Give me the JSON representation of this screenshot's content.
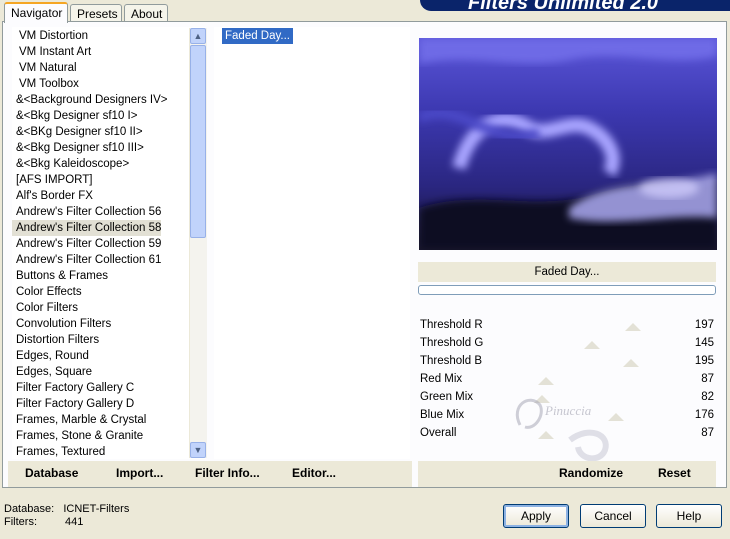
{
  "tabs": [
    "Navigator",
    "Presets",
    "About"
  ],
  "banner_title": "Filters Unlimited 2.0",
  "categories": [
    "VM Distortion",
    "VM Instant Art",
    "VM Natural",
    "VM Toolbox",
    "&<Background Designers IV>",
    "&<Bkg Designer sf10 I>",
    "&<BKg Designer sf10 II>",
    "&<Bkg Designer sf10 III>",
    "&<Bkg Kaleidoscope>",
    "[AFS IMPORT]",
    "Alf's Border FX",
    "Andrew's Filter Collection 56",
    "Andrew's Filter Collection 58",
    "Andrew's Filter Collection 59",
    "Andrew's Filter Collection 61",
    "Buttons & Frames",
    "Color Effects",
    "Color Filters",
    "Convolution Filters",
    "Distortion Filters",
    "Edges, Round",
    "Edges, Square",
    "Filter Factory Gallery C",
    "Filter Factory Gallery D",
    "Frames, Marble & Crystal",
    "Frames, Stone & Granite",
    "Frames, Textured"
  ],
  "selected_category": "Andrew's Filter Collection 58",
  "filters": [
    "Faded Day..."
  ],
  "selected_filter": "Faded Day...",
  "preview_filter_name": "Faded Day...",
  "sliders": [
    {
      "name": "Threshold R",
      "value": 197
    },
    {
      "name": "Threshold G",
      "value": 145
    },
    {
      "name": "Threshold B",
      "value": 195
    },
    {
      "name": "Red Mix",
      "value": 87
    },
    {
      "name": "Green Mix",
      "value": 82
    },
    {
      "name": "Blue Mix",
      "value": 176
    },
    {
      "name": "Overall",
      "value": 87
    }
  ],
  "left_buttons": {
    "database": "Database",
    "import": "Import...",
    "filter_info": "Filter Info...",
    "editor": "Editor..."
  },
  "right_buttons": {
    "randomize": "Randomize",
    "reset": "Reset"
  },
  "status": {
    "database_label": "Database:",
    "database_value": "ICNET-Filters",
    "filters_label": "Filters:",
    "filters_value": "441"
  },
  "dialog_buttons": {
    "apply": "Apply",
    "cancel": "Cancel",
    "help": "Help"
  },
  "watermark_text": "Pinuccia",
  "colors": {
    "accent": "#316ac5",
    "banner": "#0a246a",
    "preview_light": "#8c8cf0",
    "preview_dark": "#1a1740"
  }
}
